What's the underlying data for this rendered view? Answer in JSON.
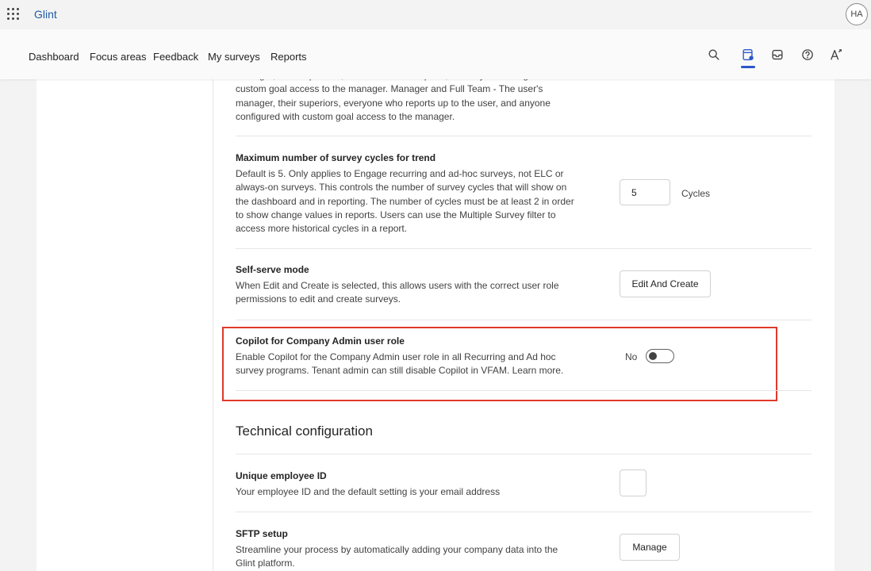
{
  "app": {
    "brand": "Glint",
    "avatar_initials": "HA"
  },
  "nav": {
    "items": [
      {
        "label": "Dashboard"
      },
      {
        "label": "Focus areas"
      },
      {
        "label": "Feedback"
      },
      {
        "label": "My surveys"
      },
      {
        "label": "Reports"
      }
    ],
    "icons": [
      "search-icon",
      "survey-settings-icon",
      "inbox-icon",
      "help-icon",
      "text-size-icon"
    ],
    "active_icon": "survey-settings-icon",
    "accent_color": "#2b57c8"
  },
  "settings": {
    "goal_access_desc": "manager, their superiors , the user's direct reports, and anyone configured with custom goal access to the manager. Manager and Full Team - The user's manager, their superiors, everyone who reports up to the user, and anyone configured with custom goal access to the manager.",
    "trend": {
      "title": "Maximum number of survey cycles for trend",
      "desc": "Default is 5. Only applies to Engage recurring and ad-hoc surveys, not ELC or always-on surveys. This controls the number of survey cycles that will show on the dashboard and in reporting. The number of cycles must be at least 2 in order to show change values in reports. Users can use the Multiple Survey filter to access more historical cycles in a report.",
      "value": "5",
      "unit": "Cycles"
    },
    "self_serve": {
      "title": "Self-serve mode",
      "desc": "When Edit and Create is selected, this allows users with the correct user role permissions to edit and create surveys.",
      "button": "Edit And Create"
    },
    "copilot": {
      "title": "Copilot for Company Admin user role",
      "desc": "Enable Copilot for the Company Admin user role in all Recurring and Ad hoc survey programs. Tenant admin can still disable Copilot in VFAM. Learn more.",
      "toggle_label": "No",
      "toggle_on": false,
      "highlight_color": "#e0392b"
    },
    "technical": {
      "heading": "Technical configuration",
      "unique_id": {
        "title": "Unique employee ID",
        "desc": "Your employee ID and the default setting is your email address"
      },
      "sftp": {
        "title": "SFTP setup",
        "desc": "Streamline your process by automatically adding your company data into the Glint platform.",
        "button": "Manage"
      }
    }
  }
}
